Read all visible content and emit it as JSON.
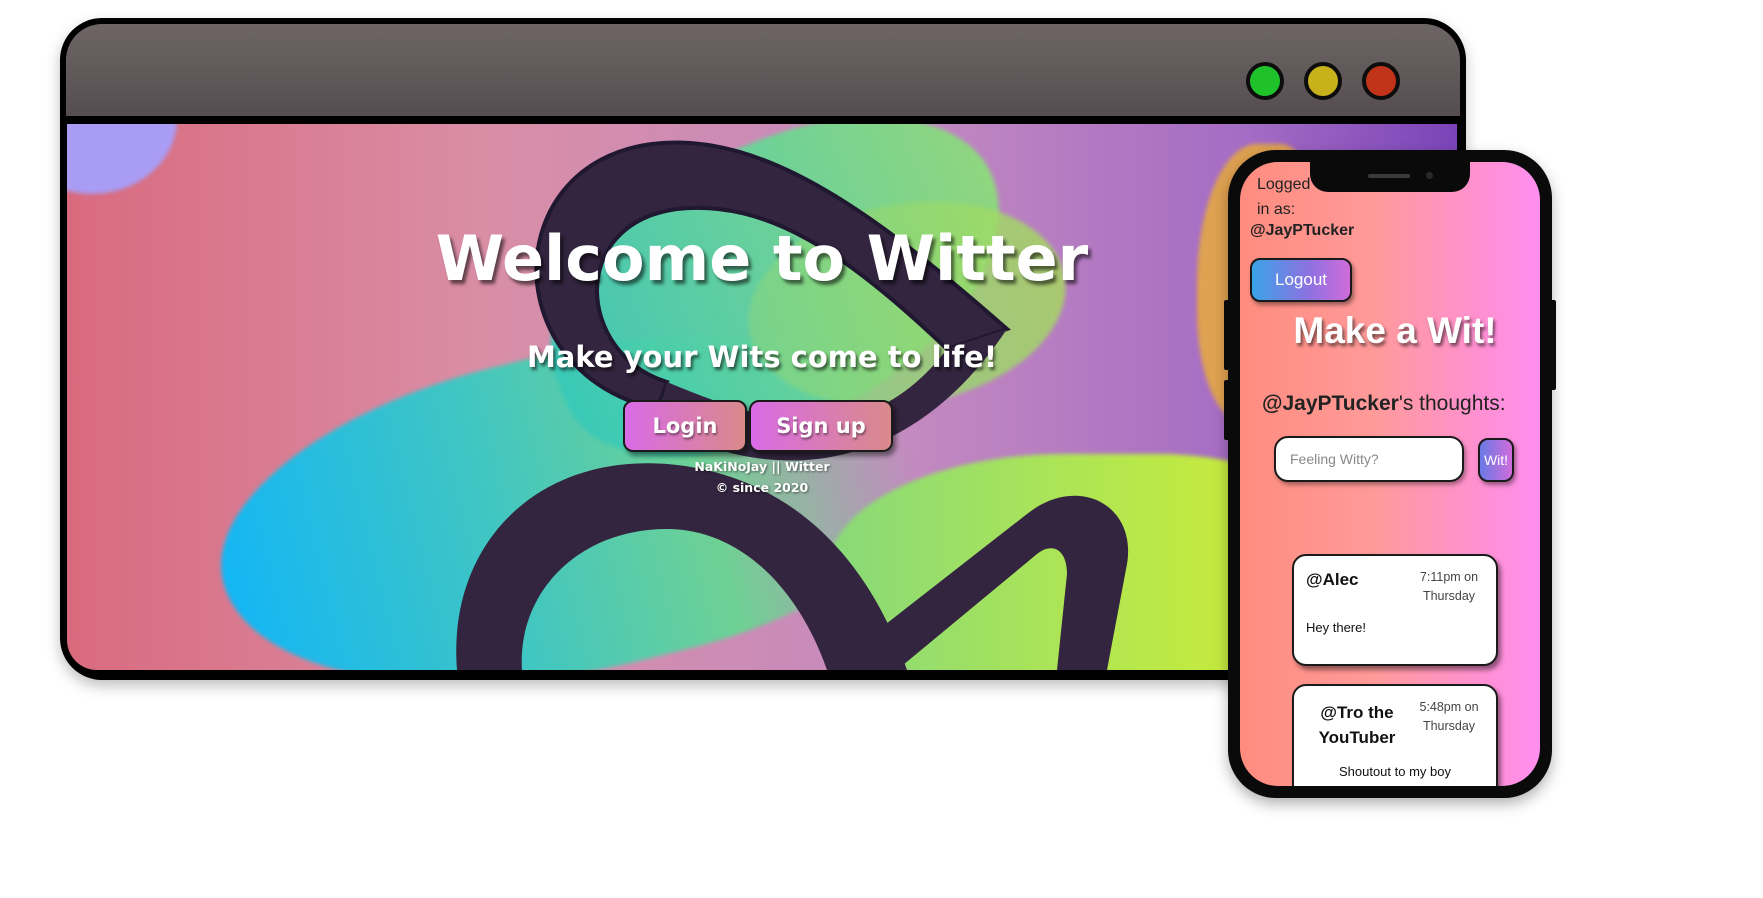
{
  "desktop": {
    "hero_title": "Welcome to Witter",
    "hero_subtitle": "Make your Wits come to life!",
    "login_label": "Login",
    "signup_label": "Sign up",
    "footer_line1": "NaKiNoJay || Witter",
    "footer_line2": "© since 2020",
    "window_controls": [
      "maximize-dot",
      "minimize-dot",
      "close-dot"
    ]
  },
  "mobile": {
    "logged_in_label": "Logged in as:",
    "username": "@JayPTucker",
    "logout_label": "Logout",
    "make_wit_title": "Make a Wit!",
    "thoughts_user": "@JayPTucker",
    "thoughts_suffix": "'s thoughts:",
    "input_placeholder": "Feeling Witty?",
    "wit_button_label": "Wit!",
    "wits": [
      {
        "author": "@Alec",
        "time": "7:11pm on Thursday",
        "text": "Hey there!"
      },
      {
        "author": "@Tro the YouTuber",
        "time": "5:48pm on Thursday",
        "text": "Shoutout to my boy"
      }
    ]
  },
  "colors": {
    "window_green": "#1fc22a",
    "window_yellow": "#c7b21c",
    "window_red": "#c23419",
    "logo_dark": "#33253f"
  }
}
